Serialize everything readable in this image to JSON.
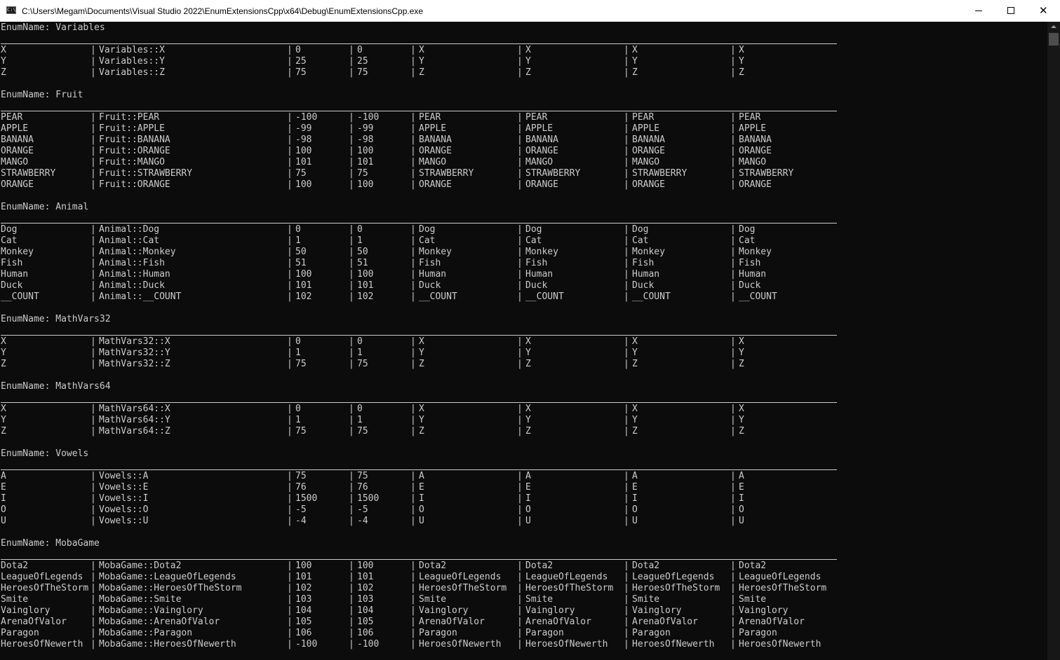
{
  "window": {
    "title": "C:\\Users\\Megam\\Documents\\Visual Studio 2022\\EnumExtensionsCpp\\x64\\Debug\\EnumExtensionsCpp.exe",
    "icon_text": "C:\\",
    "minimize_icon": "minimize-icon",
    "maximize_icon": "maximize-icon",
    "close_icon": "close-icon",
    "close_glyph": "✕"
  },
  "colors": {
    "background": "#0c0c0c",
    "text": "#cccccc",
    "titlebar": "#ffffff"
  },
  "console": {
    "sections": [
      {
        "header": "EnumName: Variables",
        "rows": [
          [
            "X",
            "Variables::X",
            "0",
            "0",
            "X",
            "X",
            "X",
            "X"
          ],
          [
            "Y",
            "Variables::Y",
            "25",
            "25",
            "Y",
            "Y",
            "Y",
            "Y"
          ],
          [
            "Z",
            "Variables::Z",
            "75",
            "75",
            "Z",
            "Z",
            "Z",
            "Z"
          ]
        ]
      },
      {
        "header": "EnumName: Fruit",
        "rows": [
          [
            "PEAR",
            "Fruit::PEAR",
            "-100",
            "-100",
            "PEAR",
            "PEAR",
            "PEAR",
            "PEAR"
          ],
          [
            "APPLE",
            "Fruit::APPLE",
            "-99",
            "-99",
            "APPLE",
            "APPLE",
            "APPLE",
            "APPLE"
          ],
          [
            "BANANA",
            "Fruit::BANANA",
            "-98",
            "-98",
            "BANANA",
            "BANANA",
            "BANANA",
            "BANANA"
          ],
          [
            "ORANGE",
            "Fruit::ORANGE",
            "100",
            "100",
            "ORANGE",
            "ORANGE",
            "ORANGE",
            "ORANGE"
          ],
          [
            "MANGO",
            "Fruit::MANGO",
            "101",
            "101",
            "MANGO",
            "MANGO",
            "MANGO",
            "MANGO"
          ],
          [
            "STRAWBERRY",
            "Fruit::STRAWBERRY",
            "75",
            "75",
            "STRAWBERRY",
            "STRAWBERRY",
            "STRAWBERRY",
            "STRAWBERRY"
          ],
          [
            "ORANGE",
            "Fruit::ORANGE",
            "100",
            "100",
            "ORANGE",
            "ORANGE",
            "ORANGE",
            "ORANGE"
          ]
        ]
      },
      {
        "header": "EnumName: Animal",
        "rows": [
          [
            "Dog",
            "Animal::Dog",
            "0",
            "0",
            "Dog",
            "Dog",
            "Dog",
            "Dog"
          ],
          [
            "Cat",
            "Animal::Cat",
            "1",
            "1",
            "Cat",
            "Cat",
            "Cat",
            "Cat"
          ],
          [
            "Monkey",
            "Animal::Monkey",
            "50",
            "50",
            "Monkey",
            "Monkey",
            "Monkey",
            "Monkey"
          ],
          [
            "Fish",
            "Animal::Fish",
            "51",
            "51",
            "Fish",
            "Fish",
            "Fish",
            "Fish"
          ],
          [
            "Human",
            "Animal::Human",
            "100",
            "100",
            "Human",
            "Human",
            "Human",
            "Human"
          ],
          [
            "Duck",
            "Animal::Duck",
            "101",
            "101",
            "Duck",
            "Duck",
            "Duck",
            "Duck"
          ],
          [
            "__COUNT",
            "Animal::__COUNT",
            "102",
            "102",
            "__COUNT",
            "__COUNT",
            "__COUNT",
            "__COUNT"
          ]
        ]
      },
      {
        "header": "EnumName: MathVars32",
        "rows": [
          [
            "X",
            "MathVars32::X",
            "0",
            "0",
            "X",
            "X",
            "X",
            "X"
          ],
          [
            "Y",
            "MathVars32::Y",
            "1",
            "1",
            "Y",
            "Y",
            "Y",
            "Y"
          ],
          [
            "Z",
            "MathVars32::Z",
            "75",
            "75",
            "Z",
            "Z",
            "Z",
            "Z"
          ]
        ]
      },
      {
        "header": "EnumName: MathVars64",
        "rows": [
          [
            "X",
            "MathVars64::X",
            "0",
            "0",
            "X",
            "X",
            "X",
            "X"
          ],
          [
            "Y",
            "MathVars64::Y",
            "1",
            "1",
            "Y",
            "Y",
            "Y",
            "Y"
          ],
          [
            "Z",
            "MathVars64::Z",
            "75",
            "75",
            "Z",
            "Z",
            "Z",
            "Z"
          ]
        ]
      },
      {
        "header": "EnumName: Vowels",
        "rows": [
          [
            "A",
            "Vowels::A",
            "75",
            "75",
            "A",
            "A",
            "A",
            "A"
          ],
          [
            "E",
            "Vowels::E",
            "76",
            "76",
            "E",
            "E",
            "E",
            "E"
          ],
          [
            "I",
            "Vowels::I",
            "1500",
            "1500",
            "I",
            "I",
            "I",
            "I"
          ],
          [
            "O",
            "Vowels::O",
            "-5",
            "-5",
            "O",
            "O",
            "O",
            "O"
          ],
          [
            "U",
            "Vowels::U",
            "-4",
            "-4",
            "U",
            "U",
            "U",
            "U"
          ]
        ]
      },
      {
        "header": "EnumName: MobaGame",
        "rows": [
          [
            "Dota2",
            "MobaGame::Dota2",
            "100",
            "100",
            "Dota2",
            "Dota2",
            "Dota2",
            "Dota2"
          ],
          [
            "LeagueOfLegends",
            "MobaGame::LeagueOfLegends",
            "101",
            "101",
            "LeagueOfLegends",
            "LeagueOfLegends",
            "LeagueOfLegends",
            "LeagueOfLegends"
          ],
          [
            "HeroesOfTheStorm",
            "MobaGame::HeroesOfTheStorm",
            "102",
            "102",
            "HeroesOfTheStorm",
            "HeroesOfTheStorm",
            "HeroesOfTheStorm",
            "HeroesOfTheStorm"
          ],
          [
            "Smite",
            "MobaGame::Smite",
            "103",
            "103",
            "Smite",
            "Smite",
            "Smite",
            "Smite"
          ],
          [
            "Vainglory",
            "MobaGame::Vainglory",
            "104",
            "104",
            "Vainglory",
            "Vainglory",
            "Vainglory",
            "Vainglory"
          ],
          [
            "ArenaOfValor",
            "MobaGame::ArenaOfValor",
            "105",
            "105",
            "ArenaOfValor",
            "ArenaOfValor",
            "ArenaOfValor",
            "ArenaOfValor"
          ],
          [
            "Paragon",
            "MobaGame::Paragon",
            "106",
            "106",
            "Paragon",
            "Paragon",
            "Paragon",
            "Paragon"
          ],
          [
            "HeroesOfNewerth",
            "MobaGame::HeroesOfNewerth",
            "-100",
            "-100",
            "HeroesOfNewerth",
            "HeroesOfNewerth",
            "HeroesOfNewerth",
            "HeroesOfNewerth"
          ]
        ]
      }
    ]
  }
}
